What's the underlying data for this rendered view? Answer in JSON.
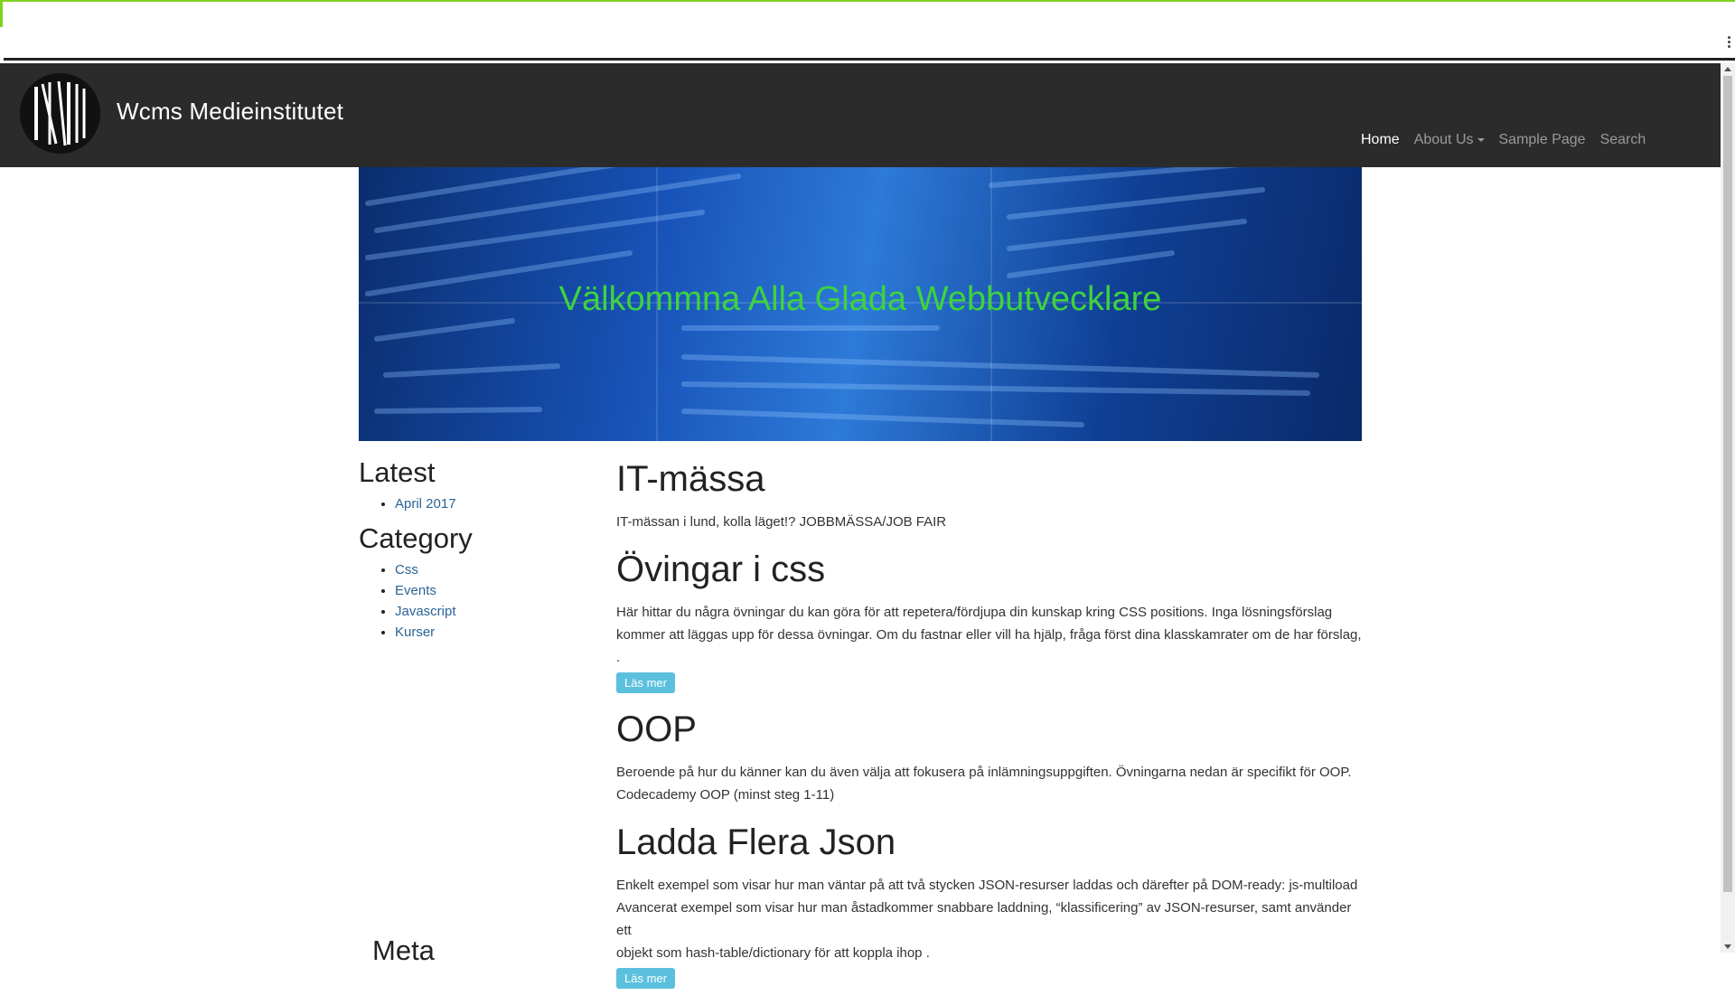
{
  "site": {
    "brand": "Wcms Medieinstitutet",
    "nav": [
      {
        "label": "Home",
        "active": true
      },
      {
        "label": "About Us",
        "dropdown": true
      },
      {
        "label": "Sample Page"
      },
      {
        "label": "Search"
      }
    ]
  },
  "hero": {
    "title": "Välkommna Alla Glada Webbutvecklare"
  },
  "sidebar": {
    "latest_heading": "Latest",
    "latest": [
      "April 2017"
    ],
    "category_heading": "Category",
    "categories": [
      "Css",
      "Events",
      "Javascript",
      "Kurser"
    ],
    "meta_heading": "Meta"
  },
  "posts": [
    {
      "title": "IT-mässa",
      "lines": [
        "IT-mässan i lund, kolla läget!? JOBBMÄSSA/JOB FAIR"
      ]
    },
    {
      "title": "Övingar i css",
      "lines": [
        "Här hittar du några övningar du kan göra för att repetera/fördjupa din kunskap kring CSS positions. Inga lösningsförslag",
        "kommer att läggas upp för dessa övningar. Om du fastnar eller vill ha hjälp, fråga först dina klasskamrater om de har förslag, ."
      ],
      "button": "Läs mer"
    },
    {
      "title": "OOP",
      "lines": [
        "Beroende på hur du känner kan du även välja att fokusera på inlämningsuppgiften. Övningarna nedan är specifikt för OOP.",
        "Codecademy OOP (minst steg 1-11)"
      ]
    },
    {
      "title": "Ladda Flera Json",
      "lines": [
        "Enkelt exempel som visar hur man väntar på att två stycken JSON-resurser laddas och därefter på DOM-ready: js-multiload",
        "Avancerat exempel som visar hur man åstadkommer snabbare laddning, “klassificering” av JSON-resurser, samt använder ett",
        "objekt som hash-table/dictionary för att koppla ihop ."
      ],
      "button": "Läs mer"
    }
  ],
  "colors": {
    "navbar": "#2b2b2b",
    "hero_title": "#3ed33e",
    "link": "#2a6496",
    "button": "#5bc0de"
  }
}
